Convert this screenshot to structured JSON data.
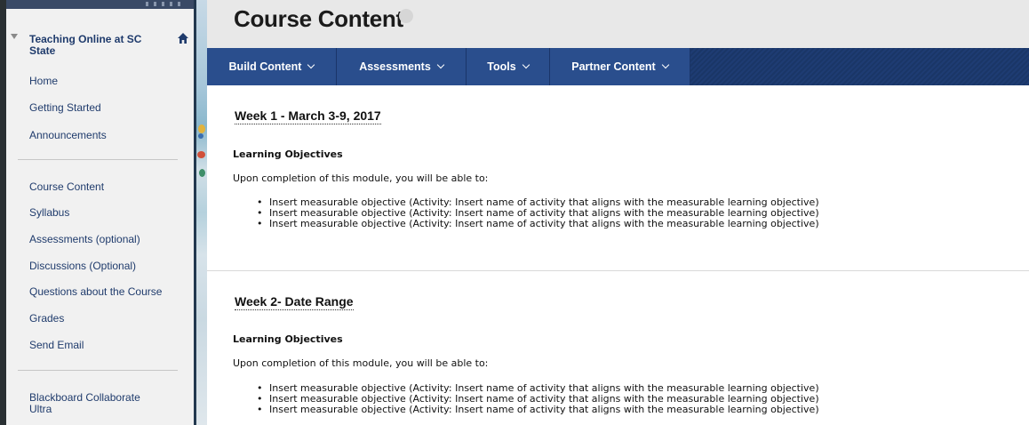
{
  "sidebar": {
    "course_title": "Teaching Online at SC State",
    "items_group1": [
      {
        "label": "Home"
      },
      {
        "label": "Getting Started"
      },
      {
        "label": "Announcements"
      }
    ],
    "items_group2": [
      {
        "label": "Course Content"
      },
      {
        "label": "Syllabus"
      },
      {
        "label": "Assessments (optional)"
      },
      {
        "label": "Discussions (Optional)"
      },
      {
        "label": "Questions about the Course"
      },
      {
        "label": "Grades"
      },
      {
        "label": "Send Email"
      }
    ],
    "items_group3": [
      {
        "label": "Blackboard Collaborate Ultra"
      }
    ]
  },
  "header": {
    "page_title": "Course Content"
  },
  "action_bar": {
    "buttons": [
      {
        "label": "Build Content"
      },
      {
        "label": "Assessments"
      },
      {
        "label": "Tools"
      },
      {
        "label": "Partner Content"
      }
    ]
  },
  "content": {
    "weeks": [
      {
        "title": "Week 1 - March 3-9, 2017",
        "heading": "Learning Objectives",
        "intro": "Upon completion of this module, you will be able to:",
        "objectives": [
          "Insert measurable objective (Activity: Insert name of activity that aligns with the measurable learning objective)",
          "Insert measurable objective  (Activity: Insert name of activity that aligns with the measurable learning objective)",
          "Insert measurable objective  (Activity: Insert name of activity that aligns with the measurable learning objective)"
        ]
      },
      {
        "title": "Week 2- Date Range",
        "heading": "Learning Objectives",
        "intro": "Upon completion of this module, you will be able to:",
        "objectives": [
          "Insert measurable objective (Activity: Insert name of activity that aligns with the measurable learning objective)",
          "Insert measurable objective  (Activity: Insert name of activity that aligns with the measurable learning objective)",
          "Insert measurable objective  (Activity: Insert name of activity that aligns with the measurable learning objective)"
        ]
      }
    ]
  },
  "colors": {
    "nav_link": "#1f3b6c",
    "action_bar": "#1e3c73",
    "action_button": "#2a4e8d",
    "title_bar": "#e8e8e8",
    "sidebar_bg": "#f1f1f1"
  },
  "icons": {
    "course_toggle": "triangle-down-icon",
    "home": "home-icon",
    "title_menu": "chevron-down-circle-icon",
    "button_menu": "chevron-down-icon"
  }
}
